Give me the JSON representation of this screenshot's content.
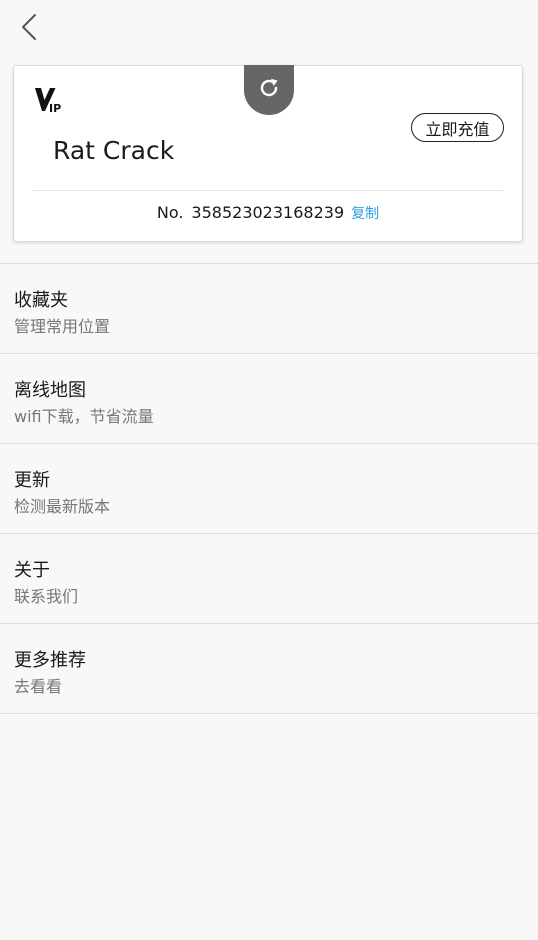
{
  "nav": {
    "back_icon": "chevron-left-icon"
  },
  "card": {
    "refresh_icon": "refresh-icon",
    "vip_logo_text": "VIP",
    "username": "Rat Crack",
    "recharge_label": "立即充值",
    "no_label": "No.",
    "no_value": "358523023168239",
    "copy_label": "复制",
    "copy_color": "#2fa0e6"
  },
  "menu": {
    "items": [
      {
        "title": "收藏夹",
        "subtitle": "管理常用位置"
      },
      {
        "title": "离线地图",
        "subtitle": "wifi下载，节省流量"
      },
      {
        "title": "更新",
        "subtitle": "检测最新版本"
      },
      {
        "title": "关于",
        "subtitle": "联系我们"
      },
      {
        "title": "更多推荐",
        "subtitle": "去看看"
      }
    ]
  }
}
